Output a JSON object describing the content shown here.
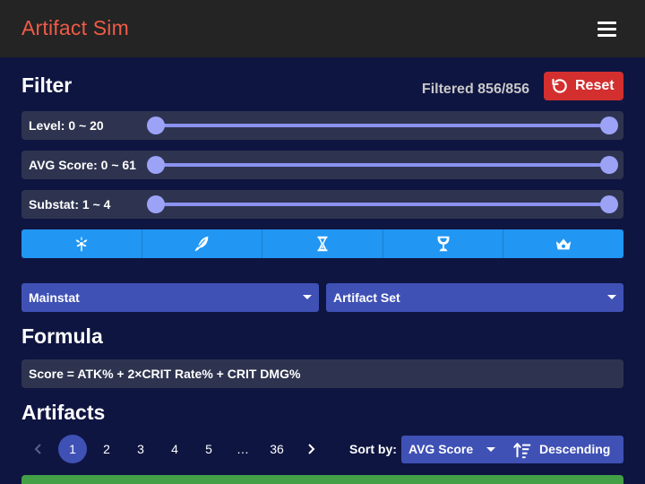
{
  "app": {
    "title": "Artifact Sim"
  },
  "filter": {
    "heading": "Filter",
    "filtered_text": "Filtered 856/856",
    "reset_label": "Reset",
    "sliders": [
      {
        "label": "Level: 0 ~ 20",
        "min": 0,
        "max": 20,
        "low": 0,
        "high": 20
      },
      {
        "label": "AVG Score: 0 ~ 61",
        "min": 0,
        "max": 61,
        "low": 0,
        "high": 61
      },
      {
        "label": "Substat: 1 ~ 4",
        "min": 1,
        "max": 4,
        "low": 1,
        "high": 4
      }
    ],
    "slots": [
      {
        "icon": "flower-icon"
      },
      {
        "icon": "plume-icon"
      },
      {
        "icon": "sands-icon"
      },
      {
        "icon": "goblet-icon"
      },
      {
        "icon": "circlet-icon"
      }
    ],
    "mainstat_label": "Mainstat",
    "artifact_set_label": "Artifact Set"
  },
  "formula": {
    "heading": "Formula",
    "value": "Score = ATK% + 2×CRIT Rate% + CRIT DMG%"
  },
  "artifacts": {
    "heading": "Artifacts",
    "pages": [
      "1",
      "2",
      "3",
      "4",
      "5"
    ],
    "ellipsis": "…",
    "last_page": "36",
    "current_page": 1,
    "sort_by_label": "Sort by:",
    "sort_field": "AVG Score",
    "sort_order": "Descending"
  },
  "colors": {
    "background": "#0f1541",
    "appbar": "#242424",
    "title": "#ef5b47",
    "reset": "#d32f2f",
    "slot_bar": "#2196f3",
    "dropdown": "#3f51b5",
    "slider_track": "#8b92f0",
    "add_button": "#43a047"
  }
}
